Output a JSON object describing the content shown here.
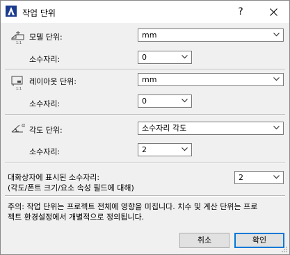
{
  "window": {
    "title": "작업 단위",
    "help_label": "?",
    "close_label": "✕",
    "app_icon": "archicad-app-icon"
  },
  "model_units": {
    "label": "모델 단위:",
    "icon": "model-units-icon",
    "unit_value": "mm",
    "decimals_label": "소수자리:",
    "decimals_value": "0"
  },
  "layout_units": {
    "label": "레이아웃 단위:",
    "icon": "layout-units-icon",
    "unit_value": "mm",
    "decimals_label": "소수자리:",
    "decimals_value": "0"
  },
  "angle_units": {
    "label": "각도 단위:",
    "icon": "angle-units-icon",
    "unit_value": "소수자리 각도",
    "decimals_label": "소수자리:",
    "decimals_value": "2"
  },
  "dialog_decimals": {
    "label_line1": "대화상자에 표시된 소수자리:",
    "label_line2": "(각도/폰트 크기/요소 속성 필드에 대해)",
    "value": "2"
  },
  "note": {
    "line1": "주의: 작업 단위는 프로젝트 전체에 영향을 미칩니다. 치수 및 계산 단위는 프로",
    "line2": "젝트 환경설정에서 개별적으로 정의됩니다."
  },
  "buttons": {
    "cancel": "취소",
    "ok": "확인"
  },
  "colors": {
    "accent": "#0078d7",
    "background": "#f0f0f0"
  }
}
